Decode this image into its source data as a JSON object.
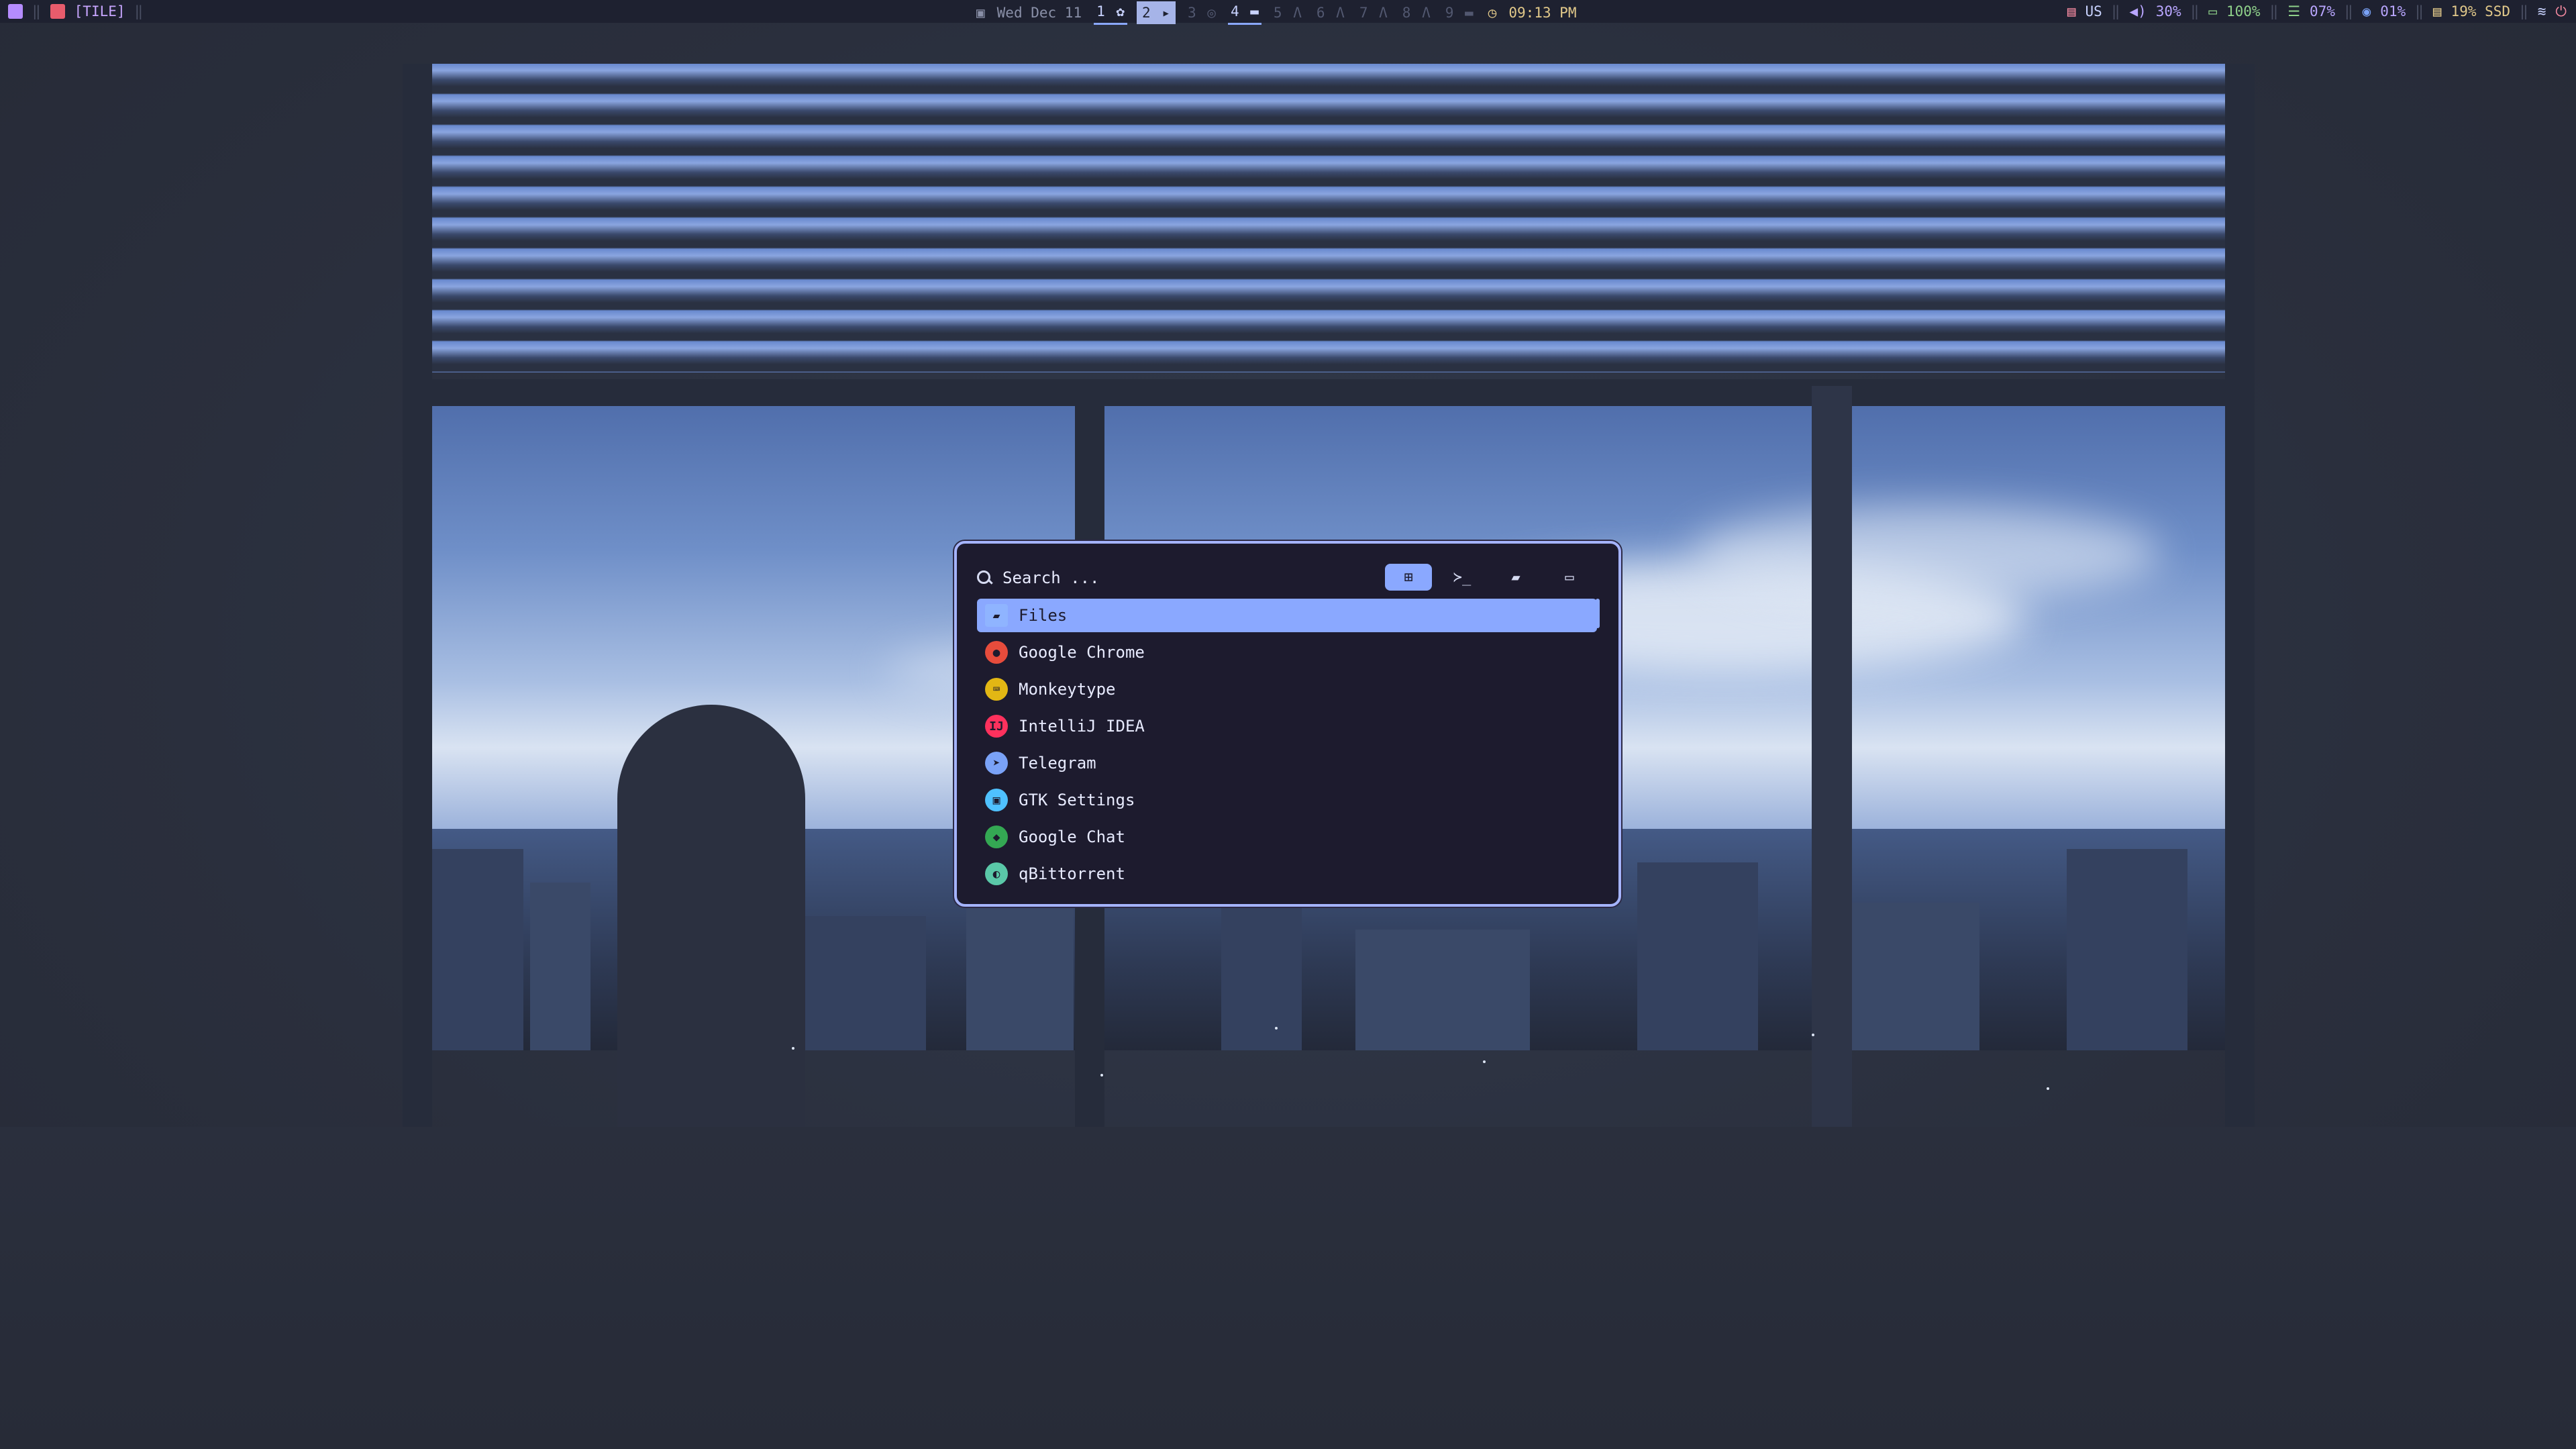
{
  "topbar": {
    "layout_label": "[TILE]",
    "date": "Wed Dec 11",
    "workspaces": [
      {
        "num": "1",
        "icon": "sunflower-icon",
        "state": "active"
      },
      {
        "num": "2",
        "icon": "terminal-icon",
        "state": "current"
      },
      {
        "num": "3",
        "icon": "github-icon",
        "state": "inactive"
      },
      {
        "num": "4",
        "icon": "window-icon",
        "state": "active"
      },
      {
        "num": "5",
        "icon": "arch-icon",
        "state": "inactive"
      },
      {
        "num": "6",
        "icon": "arch-icon",
        "state": "inactive"
      },
      {
        "num": "7",
        "icon": "arch-icon",
        "state": "inactive"
      },
      {
        "num": "8",
        "icon": "arch-icon",
        "state": "inactive"
      },
      {
        "num": "9",
        "icon": "window-icon",
        "state": "inactive"
      }
    ],
    "time": "09:13 PM",
    "keyboard_layout": "US",
    "volume": "30%",
    "battery": "100%",
    "memory": "07%",
    "cpu": "01%",
    "disk": "19% SSD"
  },
  "launcher": {
    "search": {
      "placeholder": "Search ..."
    },
    "modes": [
      {
        "name": "apps",
        "icon": "grid-icon",
        "active": true
      },
      {
        "name": "run",
        "icon": "terminal-icon",
        "active": false
      },
      {
        "name": "files",
        "icon": "folder-icon",
        "active": false
      },
      {
        "name": "windows",
        "icon": "window-icon",
        "active": false
      }
    ],
    "items": [
      {
        "label": "Files",
        "icon": "folder-icon",
        "color": "#8fb4ff",
        "selected": true
      },
      {
        "label": "Google Chrome",
        "icon": "chrome-icon",
        "color": "#e74c3c",
        "selected": false
      },
      {
        "label": "Monkeytype",
        "icon": "keyboard-icon",
        "color": "#e2b714",
        "selected": false
      },
      {
        "label": "IntelliJ IDEA",
        "icon": "intellij-icon",
        "color": "#fe315d",
        "selected": false
      },
      {
        "label": "Telegram",
        "icon": "telegram-icon",
        "color": "#7aa2f7",
        "selected": false
      },
      {
        "label": "GTK Settings",
        "icon": "settings-icon",
        "color": "#4fc1ff",
        "selected": false
      },
      {
        "label": "Google Chat",
        "icon": "chat-icon",
        "color": "#34a853",
        "selected": false
      },
      {
        "label": "qBittorrent",
        "icon": "torrent-icon",
        "color": "#5ac8a8",
        "selected": false
      }
    ]
  },
  "colors": {
    "accent": "#8aa8ff",
    "border": "#a5b4ff",
    "bar_bg": "#1e2130",
    "panel_bg": "#1d1b2e"
  }
}
